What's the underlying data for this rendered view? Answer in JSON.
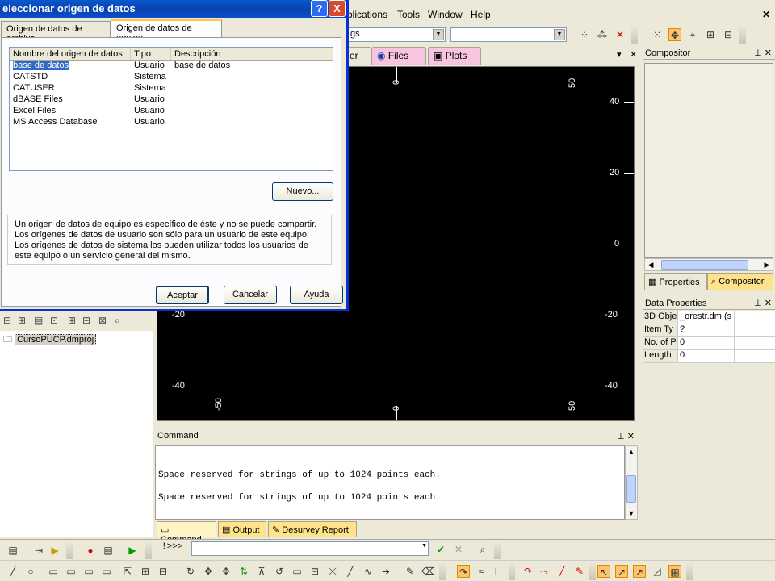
{
  "menu": {
    "applications": "plications",
    "tools": "Tools",
    "window": "Window",
    "help": "Help"
  },
  "toolbar": {
    "combo1_value": "gs",
    "combo2_value": ""
  },
  "viewer_tabs": {
    "partial": "er",
    "files": "Files",
    "plots": "Plots"
  },
  "viewer": {
    "right_ticks": [
      "40",
      "20",
      "0",
      "-20",
      "-40"
    ],
    "left_ticks": [
      "-20",
      "-40"
    ],
    "top_ticks": [
      "0",
      "50"
    ],
    "bottom_ticks": [
      "-50",
      "0",
      "50"
    ]
  },
  "compositor": {
    "title": "Compositor",
    "tab_properties": "Properties",
    "tab_compositor": "Compositor"
  },
  "data_properties": {
    "title": "Data Properties",
    "rows": [
      {
        "key": "3D Obje",
        "value": "_orestr.dm (s"
      },
      {
        "key": "Item Ty",
        "value": "?"
      },
      {
        "key": "No. of P",
        "value": "0"
      },
      {
        "key": "Length",
        "value": "0"
      }
    ]
  },
  "project": {
    "file": "CursoPUCP.dmproj"
  },
  "command": {
    "title": "Command",
    "lines": [
      "Space reserved for strings of up to 1024 points each.",
      "Space reserved for strings of up to 1024 points each."
    ],
    "tabs": [
      "Command",
      "Output",
      "Desurvey Report"
    ],
    "prompt": "!>>>"
  },
  "dialog": {
    "title": "eleccionar origen de datos",
    "help_btn": "?",
    "close_btn": "X",
    "tab_file": "Origen de datos de archivo",
    "tab_machine": "Origen de datos de equipo",
    "columns": [
      "Nombre del origen de datos",
      "Tipo",
      "Descripción"
    ],
    "rows": [
      {
        "name": "base de datos",
        "type": "Usuario",
        "desc": "base de datos"
      },
      {
        "name": "CATSTD",
        "type": "Sistema",
        "desc": ""
      },
      {
        "name": "CATUSER",
        "type": "Sistema",
        "desc": ""
      },
      {
        "name": "dBASE Files",
        "type": "Usuario",
        "desc": ""
      },
      {
        "name": "Excel Files",
        "type": "Usuario",
        "desc": ""
      },
      {
        "name": "MS Access Database",
        "type": "Usuario",
        "desc": ""
      }
    ],
    "new_btn": "Nuevo...",
    "description": "Un origen de datos de equipo es específico de éste y no se puede compartir. Los orígenes de datos de usuario son sólo para un usuario de este equipo. Los orígenes de datos de sistema los pueden utilizar todos los usuarios de este equipo o un servicio general del mismo.",
    "ok_btn": "Aceptar",
    "cancel_btn": "Cancelar",
    "help_text_btn": "Ayuda"
  },
  "colors": {
    "title_bar": "#0842b0",
    "viewer_bg": "#000000",
    "tab_pink": "#f7c5e0",
    "tab_yellow": "#ffe28a"
  }
}
